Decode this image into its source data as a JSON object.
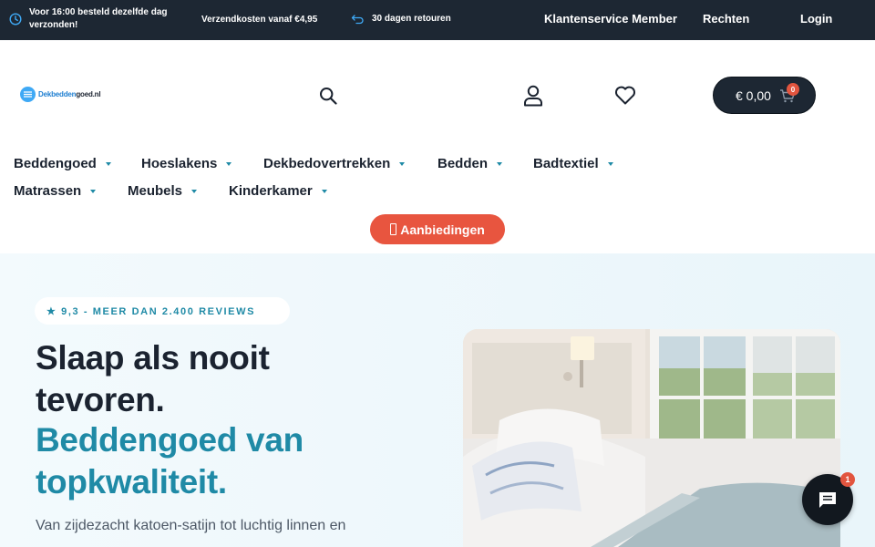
{
  "topbar": {
    "usp_delivery": "Voor 16:00 besteld dezelfde dag verzonden!",
    "usp_shipping": "Verzendkosten vanaf €4,95",
    "usp_returns": "30 dagen retouren",
    "link_service": "Klantenservice Member",
    "link_rights": "Rechten",
    "link_login": "Login"
  },
  "header": {
    "logo_part1": "Dekbedden",
    "logo_part2": "goed.nl",
    "cart_total": "€ 0,00",
    "cart_count": "0"
  },
  "nav": {
    "items": [
      "Beddengoed",
      "Hoeslakens",
      "Dekbedovertrekken",
      "Bedden",
      "Badtextiel",
      "Matrassen",
      "Meubels",
      "Kinderkamer"
    ],
    "promo_label": "Aanbiedingen"
  },
  "hero": {
    "reviews": "★ 9,3 - MEER DAN 2.400 REVIEWS",
    "title_line1": "Slaap als nooit",
    "title_line2": "tevoren.",
    "title_line3": "Beddengoed van",
    "title_line4": "topkwaliteit.",
    "lead": "Van zijdezacht katoen-satijn tot luchtig linnen en"
  },
  "chat": {
    "badge": "1"
  },
  "colors": {
    "dark": "#1d2733",
    "accent": "#1f8aa6",
    "promo": "#e8553f"
  },
  "icons": [
    "clock-icon",
    "truck-icon",
    "return-icon",
    "search-icon",
    "user-icon",
    "heart-icon",
    "cart-icon",
    "chat-icon"
  ]
}
